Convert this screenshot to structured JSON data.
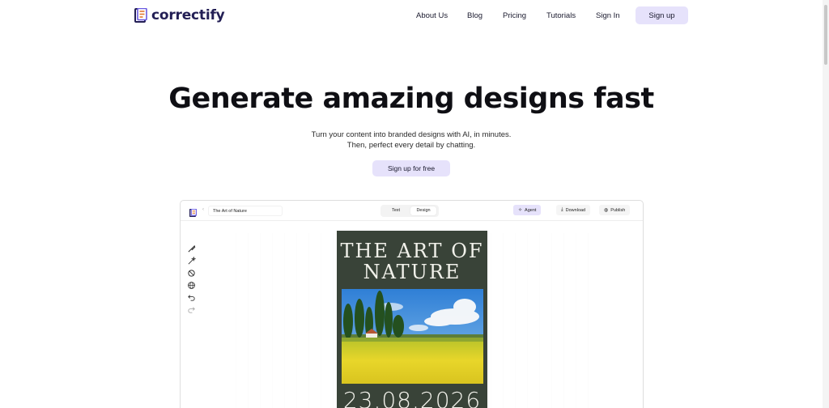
{
  "brand": {
    "name": "correctify",
    "accent": "#4b3bd6",
    "dark": "#231f55"
  },
  "nav": {
    "links": [
      "About Us",
      "Blog",
      "Pricing",
      "Tutorials",
      "Sign In"
    ],
    "signup_label": "Sign up"
  },
  "hero": {
    "title": "Generate amazing designs fast",
    "subtitle_line1": "Turn your content into branded designs with AI, in minutes.",
    "subtitle_line2": "Then, perfect every detail by chatting.",
    "cta_label": "Sign up for free"
  },
  "editor": {
    "doc_name": "The Art of Nature",
    "tabs": [
      "Text",
      "Design"
    ],
    "active_tab": "Design",
    "actions": {
      "agent": "Agent",
      "download": "Download",
      "publish": "Publish"
    },
    "tools": [
      "brush-icon",
      "magic-wand-icon",
      "no-symbol-icon",
      "globe-icon",
      "undo-icon",
      "redo-icon"
    ],
    "poster": {
      "title_line1": "THE ART OF",
      "title_line2": "NATURE",
      "date": "23.08.2026",
      "background": "#394338"
    }
  }
}
